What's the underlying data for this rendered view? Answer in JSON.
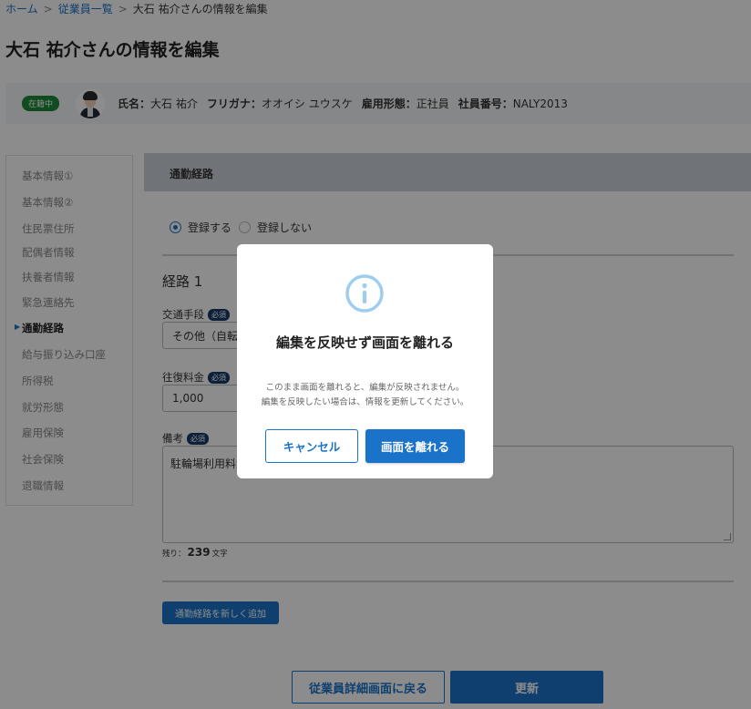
{
  "breadcrumb": {
    "home": "ホーム",
    "list": "従業員一覧",
    "current": "大石 祐介さんの情報を編集",
    "sep": ">"
  },
  "page_title": "大石 祐介さんの情報を編集",
  "employee": {
    "status": "在籍中",
    "name_label": "氏名：",
    "name": "大石 祐介",
    "kana_label": "フリガナ：",
    "kana": "オオイシ ユウスケ",
    "type_label": "雇用形態：",
    "type": "正社員",
    "number_label": "社員番号：",
    "number": "NALY2013"
  },
  "sidenav": {
    "items": [
      {
        "label": "基本情報①",
        "active": false
      },
      {
        "label": "基本情報②",
        "active": false
      },
      {
        "label": "住民票住所",
        "active": false
      },
      {
        "label": "配偶者情報",
        "active": false
      },
      {
        "label": "扶養者情報",
        "active": false
      },
      {
        "label": "緊急連絡先",
        "active": false
      },
      {
        "label": "通勤経路",
        "active": true
      },
      {
        "label": "給与振り込み口座",
        "active": false
      },
      {
        "label": "所得税",
        "active": false
      },
      {
        "label": "就労形態",
        "active": false
      },
      {
        "label": "雇用保険",
        "active": false
      },
      {
        "label": "社会保険",
        "active": false
      },
      {
        "label": "退職情報",
        "active": false
      }
    ]
  },
  "section": {
    "title": "通勤経路",
    "radio_register": "登録する",
    "radio_no_register": "登録しない",
    "route_title": "経路 1",
    "transport_label": "交通手段",
    "transport_value": "その他（自転車",
    "fare_label": "往復料金",
    "fare_value": "1,000",
    "note_label": "備考",
    "note_value": "駐輪場利用料金",
    "required": "必須",
    "remaining_prefix": "残り：",
    "remaining_count": "239",
    "remaining_suffix": "文字",
    "add_route": "通勤経路を新しく追加"
  },
  "footer": {
    "back": "従業員詳細画面に戻る",
    "update": "更新"
  },
  "dialog": {
    "title": "編集を反映せず画面を離れる",
    "message_line1": "このまま画面を離れると、編集が反映されません。",
    "message_line2": "編集を反映したい場合は、情報を更新してください。",
    "cancel": "キャンセル",
    "leave": "画面を離れる"
  },
  "colors": {
    "primary": "#1a73c8",
    "status_green": "#1e8a3a",
    "info_icon": "#9dcdf0",
    "header_bg": "#cdd4da"
  },
  "icons": {
    "info": "info-circle-icon",
    "marker": "triangle-right-icon"
  }
}
